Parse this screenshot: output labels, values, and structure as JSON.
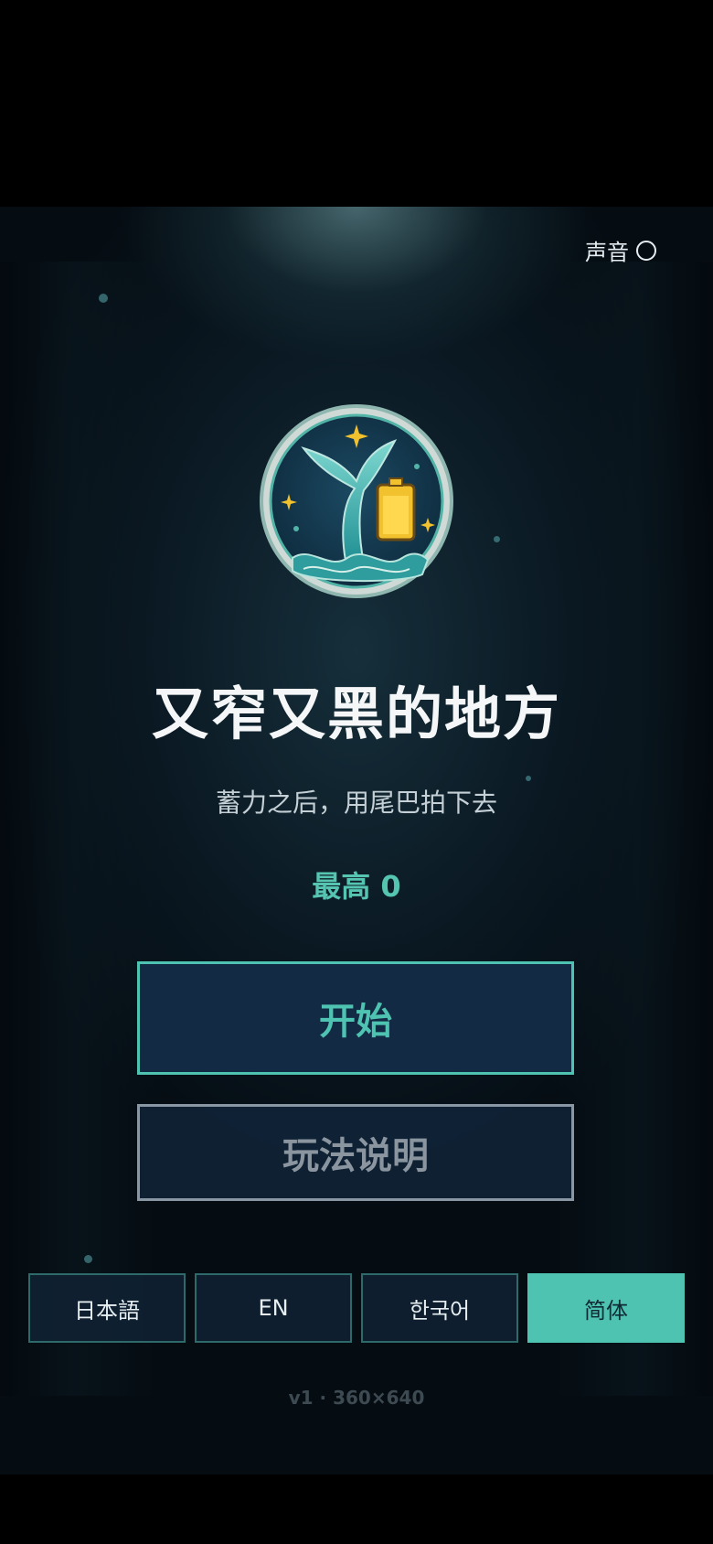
{
  "top_bar": {
    "sound_label": "声音",
    "sound_indicator": "○"
  },
  "title": "又窄又黑的地方",
  "subtitle": "蓄力之后，用尾巴拍下去",
  "best_score": "最高 0",
  "buttons": {
    "start_label": "开始",
    "help_label": "玩法说明"
  },
  "languages": [
    {
      "label": "日本語",
      "active": false
    },
    {
      "label": "EN",
      "active": false
    },
    {
      "label": "한국어",
      "active": false
    },
    {
      "label": "简体",
      "active": true
    }
  ],
  "version": "v1 · 360×640",
  "emblem": {
    "icons": [
      "whale-tail-icon",
      "battery-icon",
      "sparkle-icon",
      "wave-icon"
    ]
  },
  "colors": {
    "accent": "#4fc3b2",
    "battery": "#f2c12e",
    "background": "#0b1b24"
  }
}
